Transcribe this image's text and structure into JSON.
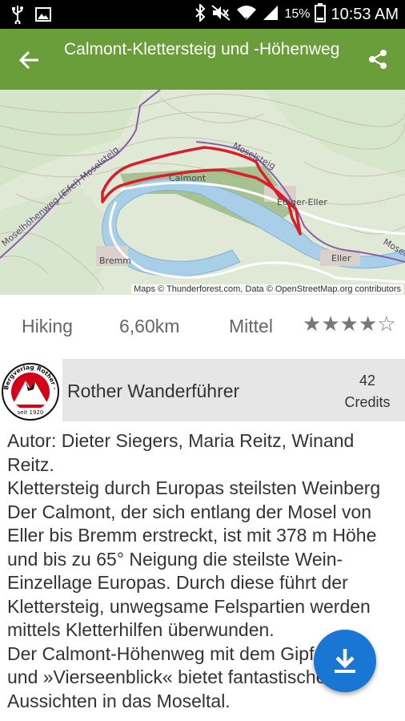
{
  "status_bar": {
    "battery_percent": "15%",
    "time": "10:53 AM",
    "icons": [
      "usb-icon",
      "image-icon",
      "bluetooth-icon",
      "mute-icon",
      "wifi-icon",
      "signal-icon",
      "battery-icon"
    ]
  },
  "app_bar": {
    "title": "Calmont-Klettersteig und -Höhenweg",
    "back_icon": "arrow-left-icon",
    "share_icon": "share-icon",
    "color": "#6a9e3b"
  },
  "map": {
    "labels": {
      "moselsteig_top": "Moselsteig",
      "moselhoehenweg": "Moselhöhenweg (Eifel) Moselsteig",
      "calmont": "Calmont",
      "ediger_eller": "Ediger-Eller",
      "bremm": "Bremm",
      "eller": "Eller",
      "mosel_right": "Mosel"
    },
    "attribution": "Maps © Thunderforest.com, Data © OpenStreetMap.org contributors",
    "route_color": "#d81e2c",
    "river_color": "#a9cfe8"
  },
  "info": {
    "activity": "Hiking",
    "distance": "6,60km",
    "difficulty": "Mittel",
    "rating": 4,
    "rating_max": 5
  },
  "publisher": {
    "logo_text_top": "Bergverlag Rother · München",
    "logo_year": "seit 1920",
    "name": "Rother Wanderführer",
    "credits_value": "42",
    "credits_label": "Credits"
  },
  "description": {
    "lines": [
      "Autor: Dieter Siegers, Maria Reitz, Winand Reitz.",
      "Klettersteig durch Europas steilsten Weinberg",
      "Der Calmont, der sich entlang der Mosel von Eller bis Bremm erstreckt, ist mit 378 m Höhe und bis zu 65° Neigung die steilste Wein-Einzellage Europas. Durch diese führt der Klettersteig, unwegsame Felspartien werden mittels Kletterhilfen überwunden.",
      "Der Calmont-Höhenweg mit dem Gipfelkreuz und »Vierseenblick« bietet fantastische Aussichten in das Moseltal."
    ]
  },
  "fab": {
    "icon": "download-icon",
    "color": "#1976d2"
  }
}
